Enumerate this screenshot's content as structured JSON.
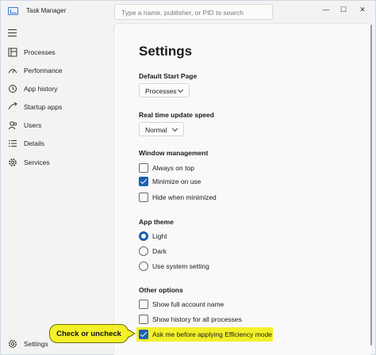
{
  "titlebar": {
    "app_title": "Task Manager",
    "search_placeholder": "Type a name, publisher, or PID to search",
    "minimize_glyph": "—",
    "maximize_glyph": "☐",
    "close_glyph": "✕"
  },
  "sidebar": {
    "items": [
      {
        "label": "Processes",
        "icon": "processes-icon"
      },
      {
        "label": "Performance",
        "icon": "performance-icon"
      },
      {
        "label": "App history",
        "icon": "app-history-icon"
      },
      {
        "label": "Startup apps",
        "icon": "startup-apps-icon"
      },
      {
        "label": "Users",
        "icon": "users-icon"
      },
      {
        "label": "Details",
        "icon": "details-icon"
      },
      {
        "label": "Services",
        "icon": "services-icon"
      }
    ],
    "settings_label": "Settings"
  },
  "main": {
    "title": "Settings",
    "default_start_page": {
      "label": "Default Start Page",
      "value": "Processes"
    },
    "update_speed": {
      "label": "Real time update speed",
      "value": "Normal"
    },
    "window_management": {
      "label": "Window management",
      "options": [
        {
          "label": "Always on top",
          "checked": false
        },
        {
          "label": "Minimize on use",
          "checked": true
        },
        {
          "label": "Hide when minimized",
          "checked": false
        }
      ]
    },
    "app_theme": {
      "label": "App theme",
      "options": [
        {
          "label": "Light",
          "selected": true
        },
        {
          "label": "Dark",
          "selected": false
        },
        {
          "label": "Use system setting",
          "selected": false
        }
      ]
    },
    "other_options": {
      "label": "Other options",
      "options": [
        {
          "label": "Show full account name",
          "checked": false
        },
        {
          "label": "Show history for all processes",
          "checked": false
        },
        {
          "label": "Ask me before applying Efficiency mode",
          "checked": true
        }
      ]
    }
  },
  "callout": {
    "text": "Check or uncheck"
  },
  "colors": {
    "accent": "#1a5fb4",
    "highlight": "#f3f02a"
  }
}
